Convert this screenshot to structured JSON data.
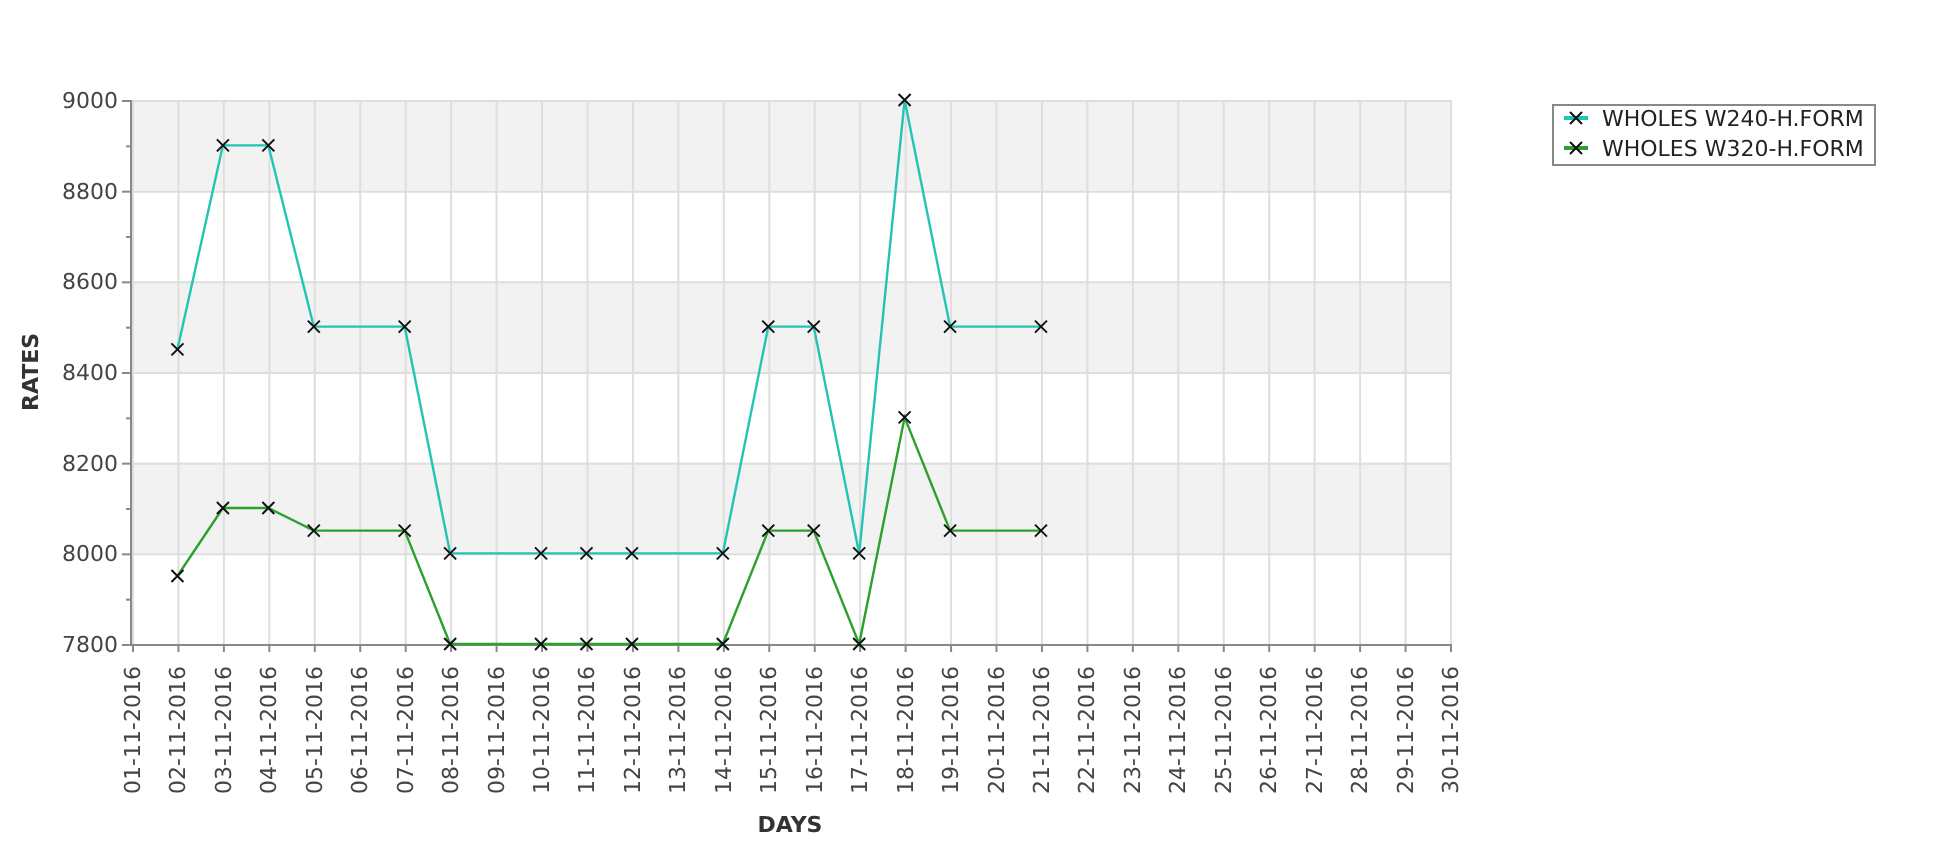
{
  "chart_data": {
    "type": "line",
    "xlabel": "DAYS",
    "ylabel": "RATES",
    "grid": true,
    "legend": true,
    "categories": [
      "01-11-2016",
      "02-11-2016",
      "03-11-2016",
      "04-11-2016",
      "05-11-2016",
      "06-11-2016",
      "07-11-2016",
      "08-11-2016",
      "09-11-2016",
      "10-11-2016",
      "11-11-2016",
      "12-11-2016",
      "13-11-2016",
      "14-11-2016",
      "15-11-2016",
      "16-11-2016",
      "17-11-2016",
      "18-11-2016",
      "19-11-2016",
      "20-11-2016",
      "21-11-2016",
      "22-11-2016",
      "23-11-2016",
      "24-11-2016",
      "25-11-2016",
      "26-11-2016",
      "27-11-2016",
      "28-11-2016",
      "29-11-2016",
      "30-11-2016"
    ],
    "series": [
      {
        "name": "WHOLES W240-H.FORM",
        "color": "#22c4b4",
        "marker": "x",
        "values": [
          null,
          8450,
          8900,
          8900,
          8500,
          null,
          8500,
          8000,
          null,
          8000,
          8000,
          8000,
          null,
          8000,
          8500,
          8500,
          8000,
          9000,
          8500,
          null,
          8500,
          null,
          null,
          null,
          null,
          null,
          null,
          null,
          null,
          null
        ]
      },
      {
        "name": "WHOLES W320-H.FORM",
        "color": "#2ca02c",
        "marker": "x",
        "values": [
          null,
          7950,
          8100,
          8100,
          8050,
          null,
          8050,
          7800,
          null,
          7800,
          7800,
          7800,
          null,
          7800,
          8050,
          8050,
          7800,
          8300,
          8050,
          null,
          8050,
          null,
          null,
          null,
          null,
          null,
          null,
          null,
          null,
          null
        ]
      }
    ],
    "ylim": [
      7800,
      9000
    ],
    "yticks": [
      7800,
      8000,
      8200,
      8400,
      8600,
      8800,
      9000
    ]
  }
}
